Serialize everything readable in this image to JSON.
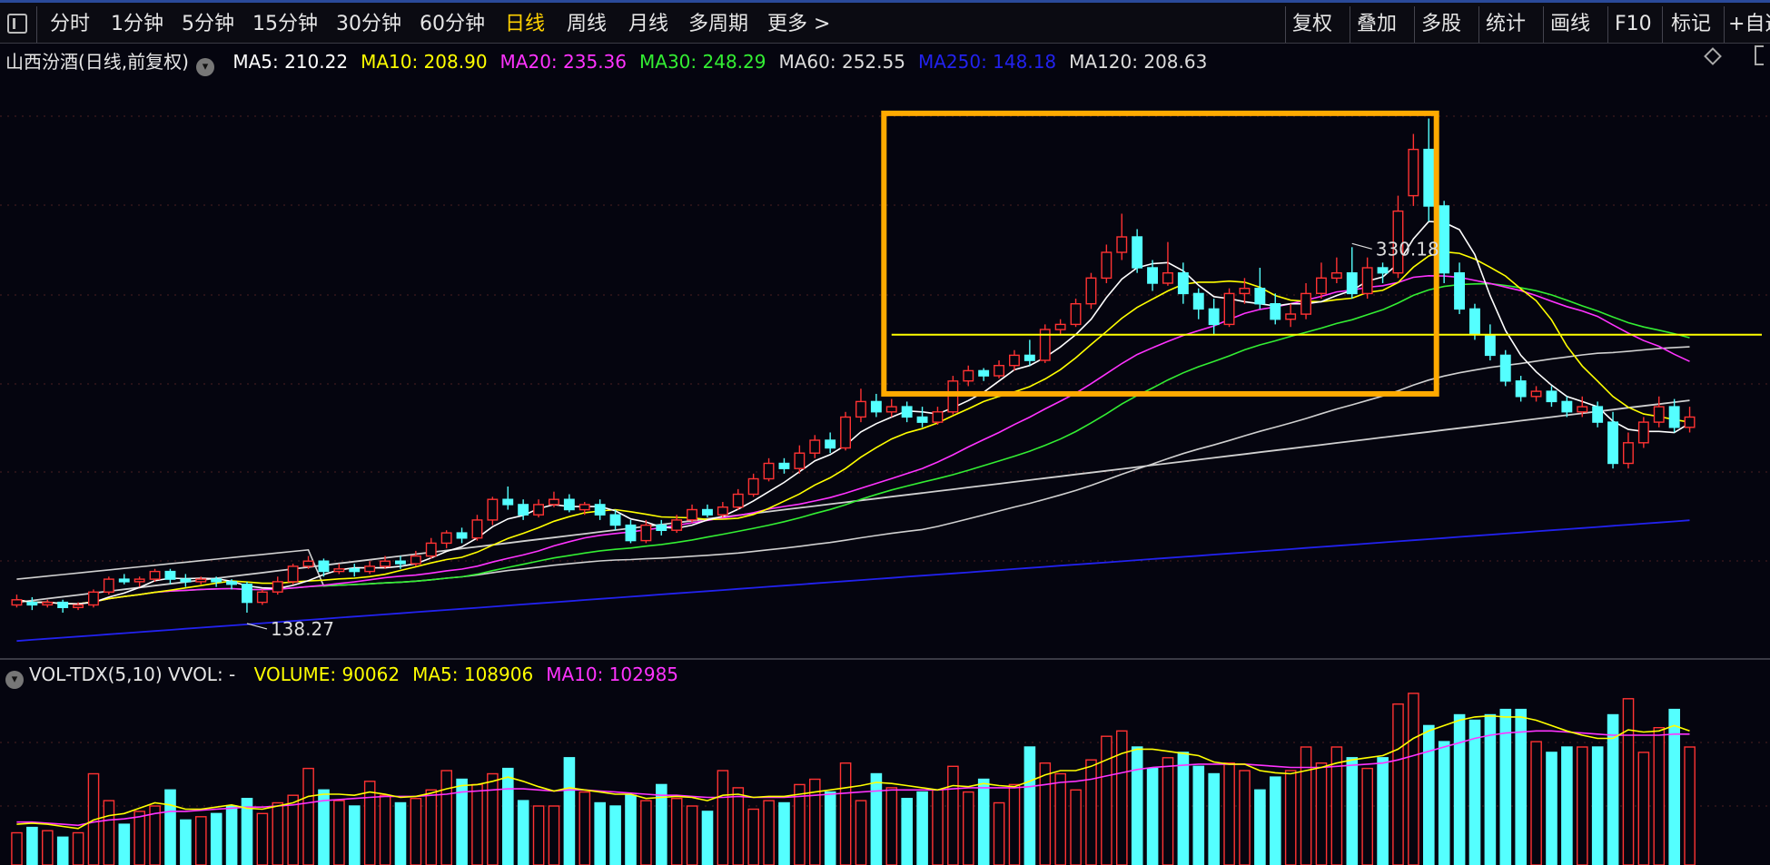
{
  "toolbar": {
    "left": [
      {
        "label": "分时"
      },
      {
        "label": "1分钟"
      },
      {
        "label": "5分钟"
      },
      {
        "label": "15分钟"
      },
      {
        "label": "30分钟"
      },
      {
        "label": "60分钟"
      },
      {
        "label": "日线",
        "active": true
      },
      {
        "label": "周线"
      },
      {
        "label": "月线"
      },
      {
        "label": "多周期"
      },
      {
        "label": "更多"
      }
    ],
    "right": [
      {
        "label": "复权"
      },
      {
        "label": "叠加"
      },
      {
        "label": "多股"
      },
      {
        "label": "统计"
      },
      {
        "label": "画线"
      },
      {
        "label": "F10"
      },
      {
        "label": "标记"
      },
      {
        "label": "+自选"
      }
    ]
  },
  "price_legend": {
    "title": "山西汾酒(日线,前复权)",
    "items": [
      {
        "label": "MA5: 210.22",
        "color": "#ffffff"
      },
      {
        "label": "MA10: 208.90",
        "color": "#ffff00"
      },
      {
        "label": "MA20: 235.36",
        "color": "#ff33ff"
      },
      {
        "label": "MA30: 248.29",
        "color": "#33ee33"
      },
      {
        "label": "MA60: 252.55",
        "color": "#dcdcdc"
      },
      {
        "label": "MA250: 148.18",
        "color": "#2222ee"
      },
      {
        "label": "MA120: 208.63",
        "color": "#dcdcdc"
      }
    ]
  },
  "volume_legend": {
    "title": "VOL-TDX(5,10) VVOL: -",
    "items": [
      {
        "label": "VOLUME: 90062",
        "color": "#ffff00"
      },
      {
        "label": "MA5: 108906",
        "color": "#ffff00"
      },
      {
        "label": "MA10: 102985",
        "color": "#ff33ff"
      }
    ]
  },
  "colors": {
    "up": "#ff3232",
    "down": "#54ffff",
    "grid": "#4a2020",
    "highlight": "#ffaa00",
    "hline": "#ffff00",
    "ma5": "#ffffff",
    "ma10": "#ffff00",
    "ma20": "#ff33ff",
    "ma30": "#33ee33",
    "ma60": "#d0d0d0",
    "ma120": "#d0d0d0",
    "ma250": "#2222ee"
  },
  "chart_data": {
    "type": "candlestick",
    "y_range": [
      120,
      345
    ],
    "high_annotation": {
      "index": 87,
      "label": "330.18"
    },
    "low_annotation": {
      "index": 15,
      "label": "138.27"
    },
    "highlight_range": {
      "from": 57,
      "to": 92,
      "low": 223,
      "high": 332
    },
    "horizontal_line": 246,
    "candles": [
      [
        141,
        143,
        145,
        140
      ],
      [
        142,
        141,
        144,
        139
      ],
      [
        141,
        142,
        143,
        140
      ],
      [
        142,
        140,
        143,
        138
      ],
      [
        140,
        141,
        142,
        139
      ],
      [
        141,
        146,
        147,
        140
      ],
      [
        146,
        151,
        152,
        145
      ],
      [
        151,
        150,
        153,
        149
      ],
      [
        150,
        151,
        152,
        148
      ],
      [
        151,
        154,
        155,
        150
      ],
      [
        154,
        151,
        155,
        149
      ],
      [
        151,
        150,
        153,
        148
      ],
      [
        150,
        151,
        152,
        149
      ],
      [
        151,
        150,
        152,
        148
      ],
      [
        150,
        149,
        151,
        147
      ],
      [
        149,
        142,
        150,
        138
      ],
      [
        142,
        146,
        147,
        141
      ],
      [
        146,
        150,
        152,
        145
      ],
      [
        150,
        156,
        157,
        149
      ],
      [
        156,
        158,
        160,
        155
      ],
      [
        158,
        154,
        159,
        152
      ],
      [
        154,
        155,
        157,
        153
      ],
      [
        155,
        154,
        157,
        152
      ],
      [
        154,
        156,
        158,
        153
      ],
      [
        156,
        158,
        160,
        155
      ],
      [
        158,
        157,
        160,
        155
      ],
      [
        157,
        160,
        162,
        156
      ],
      [
        160,
        165,
        167,
        159
      ],
      [
        165,
        169,
        170,
        163
      ],
      [
        169,
        167,
        171,
        165
      ],
      [
        167,
        174,
        176,
        166
      ],
      [
        174,
        182,
        183,
        172
      ],
      [
        182,
        180,
        187,
        178
      ],
      [
        180,
        176,
        182,
        174
      ],
      [
        176,
        180,
        182,
        175
      ],
      [
        180,
        182,
        185,
        179
      ],
      [
        182,
        178,
        184,
        177
      ],
      [
        178,
        180,
        181,
        176
      ],
      [
        180,
        176,
        182,
        174
      ],
      [
        176,
        172,
        178,
        170
      ],
      [
        172,
        166,
        174,
        165
      ],
      [
        166,
        172,
        174,
        165
      ],
      [
        172,
        170,
        174,
        168
      ],
      [
        170,
        174,
        176,
        169
      ],
      [
        174,
        178,
        180,
        173
      ],
      [
        178,
        176,
        180,
        175
      ],
      [
        176,
        179,
        181,
        175
      ],
      [
        179,
        184,
        186,
        178
      ],
      [
        184,
        190,
        192,
        183
      ],
      [
        190,
        196,
        198,
        189
      ],
      [
        196,
        194,
        198,
        192
      ],
      [
        194,
        200,
        203,
        192
      ],
      [
        200,
        205,
        207,
        198
      ],
      [
        205,
        202,
        208,
        200
      ],
      [
        202,
        214,
        216,
        201
      ],
      [
        214,
        220,
        225,
        212
      ],
      [
        220,
        216,
        223,
        214
      ],
      [
        216,
        218,
        221,
        214
      ],
      [
        218,
        214,
        220,
        212
      ],
      [
        214,
        212,
        218,
        210
      ],
      [
        212,
        216,
        218,
        211
      ],
      [
        216,
        228,
        230,
        215
      ],
      [
        228,
        232,
        234,
        226
      ],
      [
        232,
        230,
        233,
        228
      ],
      [
        230,
        234,
        236,
        229
      ],
      [
        234,
        238,
        240,
        232
      ],
      [
        238,
        236,
        244,
        234
      ],
      [
        236,
        248,
        250,
        235
      ],
      [
        248,
        250,
        252,
        246
      ],
      [
        250,
        258,
        260,
        249
      ],
      [
        258,
        268,
        270,
        256
      ],
      [
        268,
        278,
        281,
        266
      ],
      [
        278,
        284,
        293,
        275
      ],
      [
        284,
        272,
        287,
        270
      ],
      [
        272,
        266,
        275,
        263
      ],
      [
        266,
        270,
        282,
        265
      ],
      [
        270,
        262,
        274,
        258
      ],
      [
        262,
        256,
        264,
        252
      ],
      [
        256,
        250,
        260,
        246
      ],
      [
        250,
        262,
        264,
        249
      ],
      [
        262,
        264,
        268,
        258
      ],
      [
        264,
        258,
        272,
        256
      ],
      [
        258,
        252,
        262,
        250
      ],
      [
        252,
        254,
        258,
        249
      ],
      [
        254,
        262,
        266,
        252
      ],
      [
        262,
        268,
        274,
        260
      ],
      [
        268,
        270,
        276,
        266
      ],
      [
        270,
        262,
        280,
        260
      ],
      [
        262,
        272,
        276,
        260
      ],
      [
        272,
        270,
        274,
        266
      ],
      [
        270,
        294,
        300,
        268
      ],
      [
        300,
        318,
        324,
        296
      ],
      [
        318,
        296,
        330,
        290
      ],
      [
        296,
        270,
        298,
        266
      ],
      [
        270,
        256,
        274,
        254
      ],
      [
        256,
        246,
        258,
        244
      ],
      [
        246,
        238,
        250,
        236
      ],
      [
        238,
        228,
        240,
        226
      ],
      [
        228,
        222,
        230,
        220
      ],
      [
        222,
        224,
        226,
        220
      ],
      [
        224,
        220,
        226,
        218
      ],
      [
        220,
        216,
        222,
        214
      ],
      [
        216,
        218,
        222,
        214
      ],
      [
        218,
        212,
        220,
        210
      ],
      [
        212,
        196,
        216,
        194
      ],
      [
        196,
        204,
        208,
        194
      ],
      [
        204,
        212,
        214,
        202
      ],
      [
        212,
        218,
        222,
        210
      ],
      [
        218,
        210,
        221,
        208
      ],
      [
        210,
        214,
        218,
        208
      ]
    ],
    "volume": {
      "range": [
        0,
        165000
      ],
      "values": [
        30000,
        35000,
        32000,
        26000,
        30000,
        85000,
        60000,
        38000,
        50000,
        55000,
        70000,
        42000,
        45000,
        48000,
        55000,
        62000,
        48000,
        58000,
        65000,
        90000,
        70000,
        60000,
        55000,
        78000,
        65000,
        58000,
        62000,
        70000,
        88000,
        80000,
        75000,
        85000,
        90000,
        60000,
        55000,
        55000,
        100000,
        68000,
        58000,
        55000,
        65000,
        60000,
        75000,
        62000,
        55000,
        50000,
        88000,
        72000,
        52000,
        60000,
        58000,
        75000,
        80000,
        68000,
        95000,
        60000,
        85000,
        72000,
        62000,
        68000,
        70000,
        92000,
        68000,
        80000,
        58000,
        75000,
        110000,
        95000,
        85000,
        70000,
        98000,
        120000,
        125000,
        110000,
        90000,
        100000,
        105000,
        92000,
        85000,
        95000,
        88000,
        70000,
        82000,
        88000,
        110000,
        95000,
        110000,
        100000,
        90000,
        100000,
        150000,
        160000,
        130000,
        115000,
        140000,
        135000,
        140000,
        145000,
        145000,
        115000,
        105000,
        110000,
        110000,
        110000,
        140000,
        155000,
        105000,
        128000,
        145000,
        110000
      ],
      "ma5": [
        38000,
        39000,
        38000,
        36000,
        34000,
        42000,
        46000,
        48000,
        53000,
        58000,
        56000,
        52000,
        52000,
        54000,
        56000,
        53000,
        52000,
        55000,
        58000,
        64000,
        66000,
        66000,
        65000,
        68000,
        66000,
        63000,
        64000,
        67000,
        71000,
        74000,
        75000,
        78000,
        82000,
        78000,
        73000,
        69000,
        72000,
        70000,
        68000,
        66000,
        66000,
        62000,
        63000,
        64000,
        63000,
        60000,
        65000,
        66000,
        63000,
        64000,
        64000,
        66000,
        68000,
        70000,
        72000,
        74000,
        77000,
        76000,
        74000,
        72000,
        70000,
        74000,
        73000,
        76000,
        74000,
        73000,
        78000,
        84000,
        88000,
        88000,
        92000,
        98000,
        104000,
        108000,
        108000,
        106000,
        104000,
        102000,
        96000,
        94000,
        94000,
        88000,
        86000,
        85000,
        88000,
        91000,
        95000,
        98000,
        100000,
        102000,
        108000,
        118000,
        125000,
        130000,
        135000,
        138000,
        139000,
        138000,
        138000,
        135000,
        130000,
        125000,
        121000,
        118000,
        118000,
        126000,
        124000,
        125000,
        130000,
        125000
      ],
      "ma10": [
        40000,
        40000,
        39000,
        38000,
        37000,
        40000,
        42000,
        43000,
        45000,
        48000,
        50000,
        50000,
        51000,
        52000,
        53000,
        54000,
        54000,
        55000,
        56000,
        58000,
        60000,
        61000,
        62000,
        63000,
        64000,
        64000,
        64000,
        65000,
        66000,
        68000,
        69000,
        70000,
        71000,
        71000,
        70000,
        69000,
        70000,
        70000,
        69000,
        68000,
        67000,
        66000,
        65000,
        65000,
        64000,
        63000,
        63000,
        64000,
        63000,
        63000,
        63000,
        64000,
        65000,
        66000,
        67000,
        68000,
        69000,
        70000,
        70000,
        70000,
        70000,
        71000,
        72000,
        72000,
        72000,
        72000,
        73000,
        75000,
        77000,
        78000,
        80000,
        83000,
        86000,
        89000,
        91000,
        92000,
        93000,
        94000,
        94000,
        94000,
        94000,
        93000,
        92000,
        91000,
        91000,
        91000,
        92000,
        93000,
        94000,
        95000,
        98000,
        102000,
        106000,
        110000,
        114000,
        118000,
        121000,
        123000,
        124000,
        125000,
        125000,
        124000,
        123000,
        122000,
        121000,
        121000,
        121000,
        121000,
        122000,
        122000
      ]
    }
  }
}
